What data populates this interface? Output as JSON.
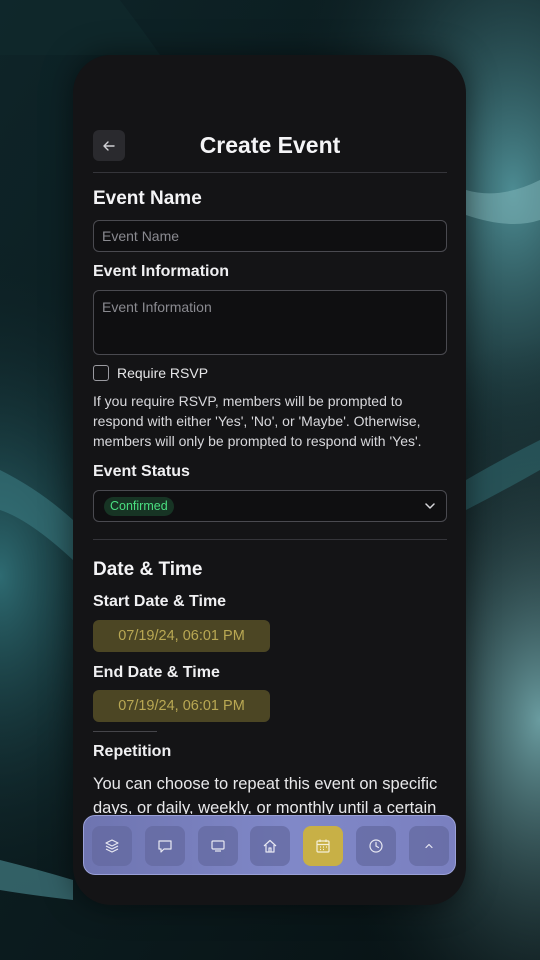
{
  "header": {
    "title": "Create Event"
  },
  "form": {
    "event_name": {
      "label": "Event Name",
      "placeholder": "Event Name"
    },
    "event_information": {
      "label": "Event Information",
      "placeholder": "Event Information"
    },
    "rsvp": {
      "label": "Require RSVP",
      "checked": false,
      "help": "If you require RSVP, members will be prompted to respond with either 'Yes', 'No', or 'Maybe'. Otherwise, members will only be prompted to respond with 'Yes'."
    },
    "event_status": {
      "label": "Event Status",
      "value": "Confirmed",
      "badge_color": "#4ade80"
    }
  },
  "date_time": {
    "title": "Date & Time",
    "start": {
      "label": "Start Date & Time",
      "value": "07/19/24, 06:01 PM"
    },
    "end": {
      "label": "End Date & Time",
      "value": "07/19/24, 06:01 PM"
    }
  },
  "repetition": {
    "title": "Repetition",
    "text": "You can choose to repeat this event on specific days, or daily, weekly, or monthly until a certain"
  },
  "navbar": {
    "items": [
      {
        "icon": "layers-icon",
        "active": false
      },
      {
        "icon": "chat-bubble-icon",
        "active": false
      },
      {
        "icon": "monitor-icon",
        "active": false
      },
      {
        "icon": "home-icon",
        "active": false
      },
      {
        "icon": "calendar-icon",
        "active": true
      },
      {
        "icon": "clock-icon",
        "active": false
      },
      {
        "icon": "chevron-up-icon",
        "active": false
      }
    ],
    "accent_color": "#c8b046"
  }
}
